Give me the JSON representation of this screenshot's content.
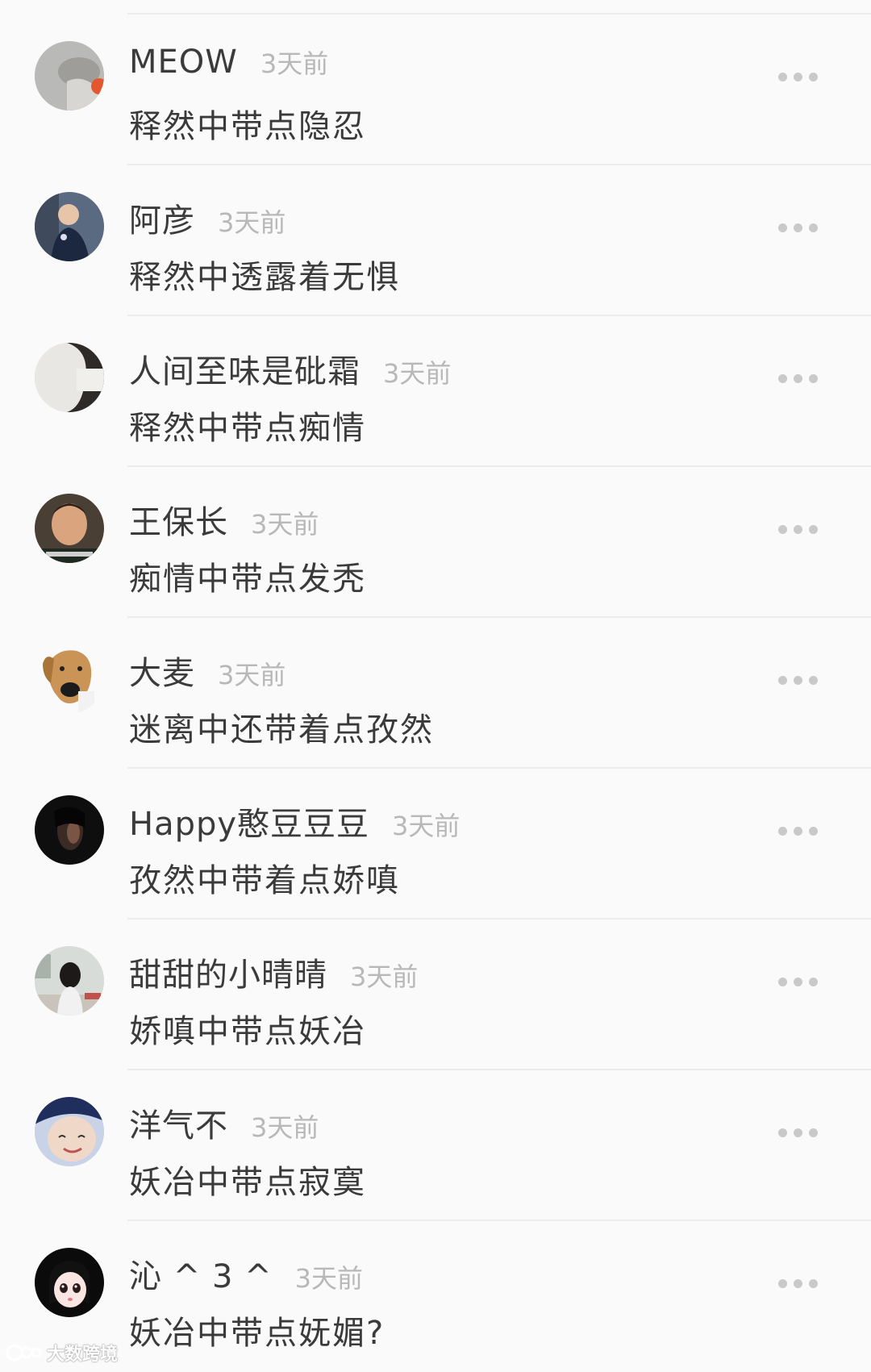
{
  "comments": [
    {
      "name": "MEOW",
      "time": "3天前",
      "text": "释然中带点隐忍",
      "avatar": "cat-photo"
    },
    {
      "name": "阿彦",
      "time": "3天前",
      "text": "释然中透露着无惧",
      "avatar": "man-selfie"
    },
    {
      "name": "人间至味是砒霜",
      "time": "3天前",
      "text": "释然中带点痴情",
      "avatar": "girl-profile"
    },
    {
      "name": "王保长",
      "time": "3天前",
      "text": "痴情中带点发秃",
      "avatar": "older-man"
    },
    {
      "name": "大麦",
      "time": "3天前",
      "text": "迷离中还带着点孜然",
      "avatar": "dog-face"
    },
    {
      "name": "Happy憨豆豆豆",
      "time": "3天前",
      "text": "孜然中带着点娇嗔",
      "avatar": "dark-portrait"
    },
    {
      "name": "甜甜的小晴晴",
      "time": "3天前",
      "text": "娇嗔中带点妖冶",
      "avatar": "girl-back"
    },
    {
      "name": "洋气不",
      "time": "3天前",
      "text": "妖冶中带点寂寞",
      "avatar": "smiling-face"
    },
    {
      "name": "沁 ^ 3 ^",
      "time": "3天前",
      "text": "妖冶中带点妩媚?",
      "avatar": "anime-girl"
    }
  ],
  "watermark": {
    "text": "大数跨境"
  },
  "colors": {
    "background": "#fafafa",
    "name": "#3b3b3b",
    "time": "#b8b8b8",
    "divider": "#ececec",
    "dots": "#c9c9c9"
  }
}
